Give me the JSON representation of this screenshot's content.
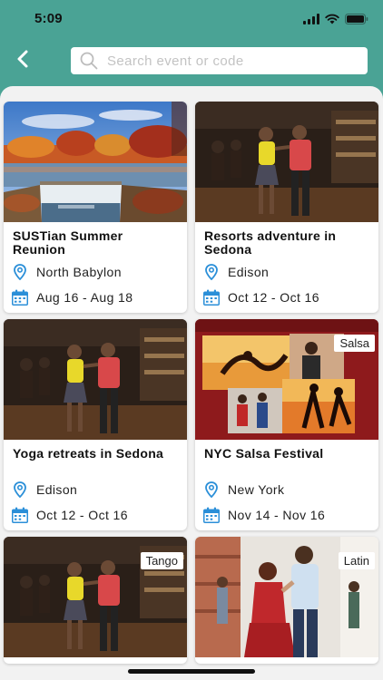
{
  "status_bar": {
    "time": "5:09"
  },
  "header": {
    "search_placeholder": "Search event or code"
  },
  "colors": {
    "header_bg": "#4aa395",
    "accent_blue": "#2b8fd8",
    "content_bg": "#f2f2f2"
  },
  "events": [
    {
      "title": "SUSTian Summer Reunion",
      "location": "North Babylon",
      "dates": "Aug 16 - Aug 18",
      "tag": "",
      "image": "waterfall-autumn"
    },
    {
      "title": "Resorts adventure in Sedona",
      "location": "Edison",
      "dates": "Oct 12 - Oct 16",
      "tag": "",
      "image": "dancing-couple-bar"
    },
    {
      "title": "Yoga retreats in Sedona",
      "location": "Edison",
      "dates": "Oct 12 - Oct 16",
      "tag": "",
      "image": "dancing-couple-bar"
    },
    {
      "title": "NYC Salsa Festival",
      "location": "New York",
      "dates": "Nov 14 - Nov 16",
      "tag": "Salsa",
      "image": "salsa-collage"
    },
    {
      "title": "",
      "location": "",
      "dates": "",
      "tag": "Tango",
      "image": "dancing-couple-bar"
    },
    {
      "title": "",
      "location": "",
      "dates": "",
      "tag": "Latin",
      "image": "latin-dance-class"
    }
  ]
}
